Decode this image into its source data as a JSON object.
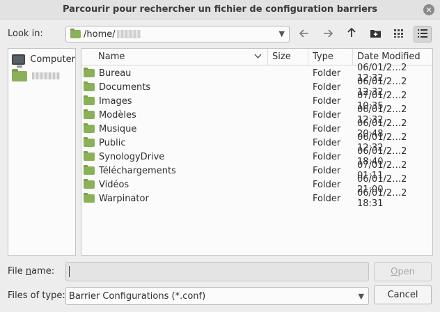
{
  "window": {
    "title": "Parcourir pour rechercher un fichier de configuration barriers",
    "close_icon": "close-icon"
  },
  "toolbar": {
    "look_in_label": "Look in:",
    "path": "/home/",
    "back_icon": "arrow-left-icon",
    "forward_icon": "arrow-right-icon",
    "up_icon": "arrow-up-icon",
    "new_folder_icon": "new-folder-icon",
    "icon_view_icon": "grid-view-icon",
    "list_view_icon": "list-view-icon"
  },
  "sidebar": {
    "items": [
      {
        "label": "Computer",
        "icon": "computer-icon"
      },
      {
        "label": "",
        "icon": "folder-icon"
      }
    ]
  },
  "files": {
    "columns": [
      "Name",
      "Size",
      "Type",
      "Date Modified"
    ],
    "rows": [
      {
        "name": "Bureau",
        "size": "",
        "type": "Folder",
        "date": "06/01/2…2 12:32"
      },
      {
        "name": "Documents",
        "size": "",
        "type": "Folder",
        "date": "06/01/2…2 12:32"
      },
      {
        "name": "Images",
        "size": "",
        "type": "Folder",
        "date": "07/01/2…2 10:35"
      },
      {
        "name": "Modèles",
        "size": "",
        "type": "Folder",
        "date": "06/01/2…2 12:32"
      },
      {
        "name": "Musique",
        "size": "",
        "type": "Folder",
        "date": "06/01/2…2 20:48"
      },
      {
        "name": "Public",
        "size": "",
        "type": "Folder",
        "date": "06/01/2…2 12:32"
      },
      {
        "name": "SynologyDrive",
        "size": "",
        "type": "Folder",
        "date": "06/01/2…2 18:40"
      },
      {
        "name": "Téléchargements",
        "size": "",
        "type": "Folder",
        "date": "07/01/2…2 01:11"
      },
      {
        "name": "Vidéos",
        "size": "",
        "type": "Folder",
        "date": "06/01/2…2 21:00"
      },
      {
        "name": "Warpinator",
        "size": "",
        "type": "Folder",
        "date": "06/01/2…2 18:31"
      }
    ]
  },
  "footer": {
    "file_name_label_a": "File ",
    "file_name_label_u": "n",
    "file_name_label_b": "ame:",
    "file_name_value": "",
    "open_label_u": "O",
    "open_label_b": "pen",
    "files_of_type_label": "Files of type:",
    "files_of_type_value": "Barrier Configurations (*.conf)",
    "cancel_label": "Cancel"
  },
  "colors": {
    "folder": "#8bb158",
    "background": "#ededed"
  }
}
